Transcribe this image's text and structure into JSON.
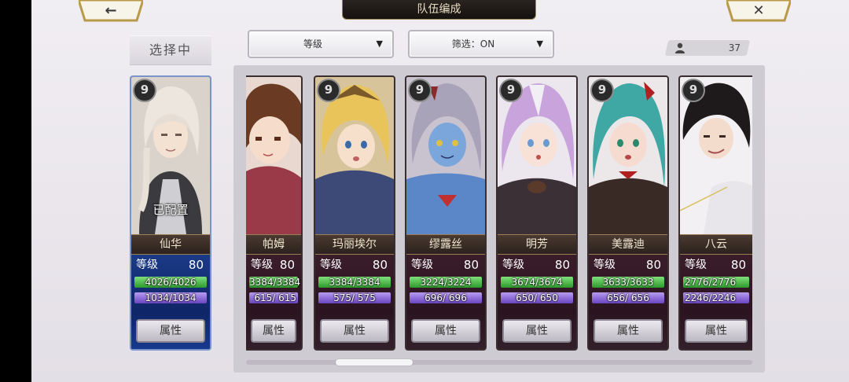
{
  "header": {
    "title": "队伍编成",
    "back_glyph": "←",
    "close_glyph": "✕"
  },
  "toolbar": {
    "sort_label": "等级",
    "filter_label": "筛选：ON",
    "dropdown_arrow": "▼",
    "unit_count": "37"
  },
  "selected_label": "选择中",
  "level_label": "等级",
  "attr_label": "属性",
  "selected_card": {
    "name": "仙华",
    "rarity": "9",
    "level": "80",
    "hp": "4026/4026",
    "mp": "1034/1034",
    "status": "已配置"
  },
  "cards": [
    {
      "name": "帕姆",
      "rarity": "9",
      "level": "80",
      "hp": "3384/3384",
      "mp": "615/ 615"
    },
    {
      "name": "玛丽埃尔",
      "rarity": "9",
      "level": "80",
      "hp": "3384/3384",
      "mp": "575/ 575"
    },
    {
      "name": "缪露丝",
      "rarity": "9",
      "level": "80",
      "hp": "3224/3224",
      "mp": "696/ 696"
    },
    {
      "name": "明芳",
      "rarity": "9",
      "level": "80",
      "hp": "3674/3674",
      "mp": "650/ 650"
    },
    {
      "name": "美露迪",
      "rarity": "9",
      "level": "80",
      "hp": "3633/3633",
      "mp": "656/ 656"
    },
    {
      "name": "八云",
      "rarity": "9",
      "level": "80",
      "hp": "2776/2776",
      "mp": "2246/2246"
    }
  ],
  "colors": {
    "hp": "#3fae3b",
    "mp": "#7a55cc",
    "selected_border": "#7a93c8"
  }
}
